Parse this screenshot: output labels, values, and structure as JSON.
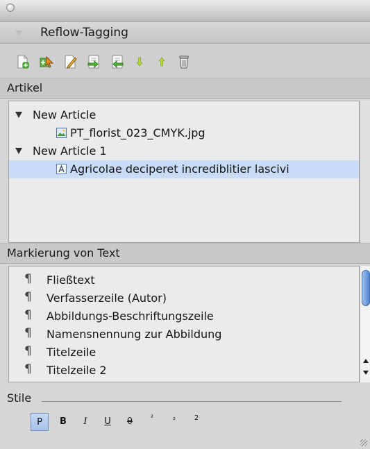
{
  "panel": {
    "title": "Reflow-Tagging"
  },
  "toolbar": {
    "buttons": [
      {
        "name": "new-article"
      },
      {
        "name": "add-to-article"
      },
      {
        "name": "edit-article"
      },
      {
        "name": "move-in"
      },
      {
        "name": "move-out"
      },
      {
        "name": "move-down"
      },
      {
        "name": "move-up"
      },
      {
        "name": "delete"
      }
    ]
  },
  "articles": {
    "heading": "Artikel",
    "items": [
      {
        "label": "New Article",
        "type": "group"
      },
      {
        "label": "PT_florist_023_CMYK.jpg",
        "type": "image"
      },
      {
        "label": "New Article 1",
        "type": "group"
      },
      {
        "label": "Agricolae deciperet incrediblitier lascivi",
        "type": "text",
        "selected": true
      }
    ]
  },
  "markup": {
    "heading": "Markierung von Text",
    "pilcrow": "¶",
    "items": [
      "Fließtext",
      "Verfasserzeile (Autor)",
      "Abbildungs-Beschriftungszeile",
      "Namensnennung zur Abbildung",
      "Titelzeile",
      "Titelzeile 2"
    ]
  },
  "styles": {
    "heading": "Stile",
    "buttons": {
      "paragraph": "P",
      "bold": "B",
      "italic": "I",
      "underline": "U",
      "strikethrough": "θ",
      "superscript": "²",
      "subscript": "₂",
      "small": "2"
    },
    "selected": "paragraph"
  },
  "colors": {
    "selection": "#c8dcf7",
    "scroll_thumb": "#4f86d4",
    "panel_bg": "#d6d6d6"
  }
}
